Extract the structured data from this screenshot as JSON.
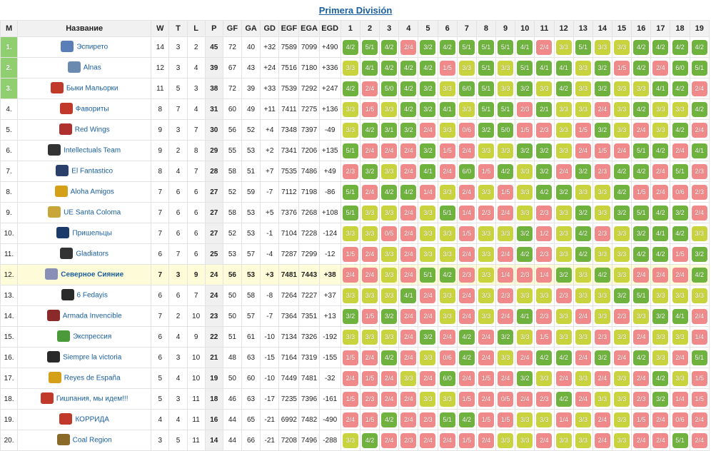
{
  "title": "Primera División",
  "columns": [
    "M",
    "Название",
    "W",
    "T",
    "L",
    "P",
    "GF",
    "GA",
    "GD",
    "EGF",
    "EGA",
    "EGD",
    "1",
    "2",
    "3",
    "4",
    "5",
    "6",
    "7",
    "8",
    "9",
    "10",
    "11",
    "12",
    "13",
    "14",
    "15",
    "16",
    "17",
    "18",
    "19"
  ],
  "colors": {
    "win": "#6fb33e",
    "draw": "#c9d33e",
    "loss": "#f08a8a",
    "top": "#8fcf6f",
    "link": "#1a5fa0"
  },
  "rows": [
    {
      "pos": "1.",
      "name": "Эспирето",
      "logo_color": "#5a7fb8",
      "w": "14",
      "t": "3",
      "l": "2",
      "p": "45",
      "gf": "72",
      "ga": "40",
      "gd": "+32",
      "egf": "7589",
      "ega": "7099",
      "egd": "+490",
      "hl": false,
      "top": true,
      "results": [
        "4/2",
        "5/1",
        "4/2",
        "2/4",
        "3/2",
        "4/2",
        "5/1",
        "5/1",
        "5/1",
        "4/1",
        "2/4",
        "3/3",
        "5/1",
        "3/3",
        "3/3",
        "4/2",
        "4/2",
        "4/2",
        "4/2"
      ]
    },
    {
      "pos": "2.",
      "name": "Alnas",
      "logo_color": "#6a8ab0",
      "w": "12",
      "t": "3",
      "l": "4",
      "p": "39",
      "gf": "67",
      "ga": "43",
      "gd": "+24",
      "egf": "7516",
      "ega": "7180",
      "egd": "+336",
      "hl": false,
      "top": true,
      "results": [
        "3/3",
        "4/1",
        "4/2",
        "4/2",
        "4/2",
        "1/5",
        "3/3",
        "5/1",
        "3/3",
        "5/1",
        "4/1",
        "4/1",
        "3/3",
        "3/2",
        "1/5",
        "4/2",
        "2/4",
        "6/0",
        "5/1"
      ]
    },
    {
      "pos": "3.",
      "name": "Быки Мальорки",
      "logo_color": "#c0392b",
      "w": "11",
      "t": "5",
      "l": "3",
      "p": "38",
      "gf": "72",
      "ga": "39",
      "gd": "+33",
      "egf": "7539",
      "ega": "7292",
      "egd": "+247",
      "hl": false,
      "top": true,
      "results": [
        "4/2",
        "2/4",
        "5/0",
        "4/2",
        "3/2",
        "3/3",
        "6/0",
        "5/1",
        "3/3",
        "3/2",
        "3/3",
        "4/2",
        "3/3",
        "3/2",
        "3/3",
        "3/3",
        "4/1",
        "4/2",
        "2/4"
      ]
    },
    {
      "pos": "4.",
      "name": "Фавориты",
      "logo_color": "#c0392b",
      "w": "8",
      "t": "7",
      "l": "4",
      "p": "31",
      "gf": "60",
      "ga": "49",
      "gd": "+11",
      "egf": "7411",
      "ega": "7275",
      "egd": "+136",
      "hl": false,
      "top": false,
      "results": [
        "3/3",
        "1/5",
        "3/3",
        "4/2",
        "3/2",
        "4/1",
        "3/3",
        "5/1",
        "5/1",
        "2/3",
        "2/1",
        "3/3",
        "3/3",
        "2/4",
        "3/3",
        "4/2",
        "3/3",
        "3/3",
        "4/2"
      ]
    },
    {
      "pos": "5.",
      "name": "Red Wings",
      "logo_color": "#b03030",
      "w": "9",
      "t": "3",
      "l": "7",
      "p": "30",
      "gf": "56",
      "ga": "52",
      "gd": "+4",
      "egf": "7348",
      "ega": "7397",
      "egd": "-49",
      "hl": false,
      "top": false,
      "results": [
        "3/3",
        "4/2",
        "3/1",
        "3/2",
        "2/4",
        "3/3",
        "0/6",
        "3/2",
        "5/0",
        "1/5",
        "2/3",
        "3/3",
        "1/5",
        "3/2",
        "3/3",
        "2/4",
        "3/3",
        "4/2",
        "2/4"
      ]
    },
    {
      "pos": "6.",
      "name": "Intellectuals Team",
      "logo_color": "#333333",
      "w": "9",
      "t": "2",
      "l": "8",
      "p": "29",
      "gf": "55",
      "ga": "53",
      "gd": "+2",
      "egf": "7341",
      "ega": "7206",
      "egd": "+135",
      "hl": false,
      "top": false,
      "results": [
        "5/1",
        "2/4",
        "2/4",
        "2/4",
        "3/2",
        "1/5",
        "2/4",
        "3/3",
        "3/3",
        "3/2",
        "3/2",
        "3/3",
        "2/4",
        "1/5",
        "2/4",
        "5/1",
        "4/2",
        "2/4",
        "4/1"
      ]
    },
    {
      "pos": "7.",
      "name": "El Fantastico",
      "logo_color": "#2a3f6a",
      "w": "8",
      "t": "4",
      "l": "7",
      "p": "28",
      "gf": "58",
      "ga": "51",
      "gd": "+7",
      "egf": "7535",
      "ega": "7486",
      "egd": "+49",
      "hl": false,
      "top": false,
      "results": [
        "2/3",
        "3/2",
        "3/3",
        "2/4",
        "4/1",
        "2/4",
        "6/0",
        "1/5",
        "4/2",
        "3/3",
        "3/2",
        "2/4",
        "3/2",
        "2/3",
        "4/2",
        "4/2",
        "2/4",
        "5/1",
        "2/3"
      ]
    },
    {
      "pos": "8.",
      "name": "Aloha Amigos",
      "logo_color": "#d4a017",
      "w": "7",
      "t": "6",
      "l": "6",
      "p": "27",
      "gf": "52",
      "ga": "59",
      "gd": "-7",
      "egf": "7112",
      "ega": "7198",
      "egd": "-86",
      "hl": false,
      "top": false,
      "results": [
        "5/1",
        "2/4",
        "4/2",
        "4/2",
        "1/4",
        "3/3",
        "2/4",
        "3/3",
        "1/5",
        "3/3",
        "4/2",
        "3/2",
        "3/3",
        "3/3",
        "4/2",
        "1/5",
        "2/4",
        "0/6",
        "2/3"
      ]
    },
    {
      "pos": "9.",
      "name": "UE Santa Coloma",
      "logo_color": "#c8a63a",
      "w": "7",
      "t": "6",
      "l": "6",
      "p": "27",
      "gf": "58",
      "ga": "53",
      "gd": "+5",
      "egf": "7376",
      "ega": "7268",
      "egd": "+108",
      "hl": false,
      "top": false,
      "results": [
        "5/1",
        "3/3",
        "3/3",
        "2/4",
        "3/3",
        "5/1",
        "1/4",
        "2/3",
        "2/4",
        "3/3",
        "2/3",
        "3/3",
        "3/2",
        "3/3",
        "3/2",
        "5/1",
        "4/2",
        "3/2",
        "2/4"
      ]
    },
    {
      "pos": "10.",
      "name": "Пришельцы",
      "logo_color": "#1a3a6a",
      "w": "7",
      "t": "6",
      "l": "6",
      "p": "27",
      "gf": "52",
      "ga": "53",
      "gd": "-1",
      "egf": "7104",
      "ega": "7228",
      "egd": "-124",
      "hl": false,
      "top": false,
      "results": [
        "3/3",
        "3/3",
        "0/5",
        "2/4",
        "3/3",
        "3/3",
        "1/5",
        "3/3",
        "3/3",
        "3/2",
        "1/2",
        "3/3",
        "4/2",
        "2/3",
        "3/3",
        "3/2",
        "4/1",
        "4/2",
        "3/3"
      ]
    },
    {
      "pos": "11.",
      "name": "Gladiators",
      "logo_color": "#333333",
      "w": "6",
      "t": "7",
      "l": "6",
      "p": "25",
      "gf": "53",
      "ga": "57",
      "gd": "-4",
      "egf": "7287",
      "ega": "7299",
      "egd": "-12",
      "hl": false,
      "top": false,
      "results": [
        "1/5",
        "2/4",
        "3/3",
        "2/4",
        "3/3",
        "3/3",
        "2/4",
        "3/3",
        "2/4",
        "4/2",
        "2/3",
        "3/3",
        "4/2",
        "3/3",
        "3/3",
        "4/2",
        "4/2",
        "1/5",
        "3/2"
      ]
    },
    {
      "pos": "12.",
      "name": "Северное Сияние",
      "logo_color": "#8a8fb8",
      "w": "7",
      "t": "3",
      "l": "9",
      "p": "24",
      "gf": "56",
      "ga": "53",
      "gd": "+3",
      "egf": "7481",
      "ega": "7443",
      "egd": "+38",
      "hl": true,
      "top": false,
      "results": [
        "2/4",
        "2/4",
        "3/3",
        "2/4",
        "5/1",
        "4/2",
        "2/3",
        "3/3",
        "1/4",
        "2/3",
        "1/4",
        "3/2",
        "3/3",
        "4/2",
        "3/3",
        "2/4",
        "2/4",
        "2/4",
        "4/2"
      ]
    },
    {
      "pos": "13.",
      "name": "6 Fedayis",
      "logo_color": "#2a2a2a",
      "w": "6",
      "t": "6",
      "l": "7",
      "p": "24",
      "gf": "50",
      "ga": "58",
      "gd": "-8",
      "egf": "7264",
      "ega": "7227",
      "egd": "+37",
      "hl": false,
      "top": false,
      "results": [
        "3/3",
        "3/3",
        "3/3",
        "4/1",
        "2/4",
        "3/3",
        "2/4",
        "3/3",
        "2/3",
        "3/3",
        "3/3",
        "2/3",
        "3/3",
        "3/3",
        "3/2",
        "5/1",
        "3/3",
        "3/3",
        "3/3"
      ]
    },
    {
      "pos": "14.",
      "name": "Armada Invencible",
      "logo_color": "#8a2a2a",
      "w": "7",
      "t": "2",
      "l": "10",
      "p": "23",
      "gf": "50",
      "ga": "57",
      "gd": "-7",
      "egf": "7364",
      "ega": "7351",
      "egd": "+13",
      "hl": false,
      "top": false,
      "results": [
        "3/2",
        "1/5",
        "3/2",
        "2/4",
        "2/4",
        "3/3",
        "2/4",
        "3/3",
        "2/4",
        "4/1",
        "2/3",
        "3/3",
        "2/4",
        "3/3",
        "2/3",
        "3/3",
        "3/2",
        "4/1",
        "2/4"
      ]
    },
    {
      "pos": "15.",
      "name": "Экспрессия",
      "logo_color": "#4a9a3a",
      "w": "6",
      "t": "4",
      "l": "9",
      "p": "22",
      "gf": "51",
      "ga": "61",
      "gd": "-10",
      "egf": "7134",
      "ega": "7326",
      "egd": "-192",
      "hl": false,
      "top": false,
      "results": [
        "3/3",
        "3/3",
        "3/3",
        "2/4",
        "3/2",
        "2/4",
        "4/2",
        "2/4",
        "3/2",
        "3/3",
        "1/5",
        "3/3",
        "3/3",
        "2/3",
        "3/3",
        "2/4",
        "3/3",
        "3/3",
        "1/4"
      ]
    },
    {
      "pos": "16.",
      "name": "Siempre la victoria",
      "logo_color": "#2a2a2a",
      "w": "6",
      "t": "3",
      "l": "10",
      "p": "21",
      "gf": "48",
      "ga": "63",
      "gd": "-15",
      "egf": "7164",
      "ega": "7319",
      "egd": "-155",
      "hl": false,
      "top": false,
      "results": [
        "1/5",
        "2/4",
        "4/2",
        "2/4",
        "3/3",
        "0/6",
        "4/2",
        "2/4",
        "3/3",
        "2/4",
        "4/2",
        "4/2",
        "2/4",
        "3/2",
        "2/4",
        "4/2",
        "3/3",
        "2/4",
        "5/1"
      ]
    },
    {
      "pos": "17.",
      "name": "Reyes de España",
      "logo_color": "#d4a017",
      "w": "5",
      "t": "4",
      "l": "10",
      "p": "19",
      "gf": "50",
      "ga": "60",
      "gd": "-10",
      "egf": "7449",
      "ega": "7481",
      "egd": "-32",
      "hl": false,
      "top": false,
      "results": [
        "2/4",
        "1/5",
        "2/4",
        "3/3",
        "2/4",
        "6/0",
        "2/4",
        "1/5",
        "2/4",
        "3/2",
        "3/3",
        "2/4",
        "3/3",
        "2/4",
        "3/3",
        "2/4",
        "4/2",
        "3/3",
        "1/5"
      ]
    },
    {
      "pos": "18.",
      "name": "Гишпания, мы идем!!!",
      "logo_color": "#c0392b",
      "w": "5",
      "t": "3",
      "l": "11",
      "p": "18",
      "gf": "46",
      "ga": "63",
      "gd": "-17",
      "egf": "7235",
      "ega": "7396",
      "egd": "-161",
      "hl": false,
      "top": false,
      "results": [
        "1/5",
        "2/3",
        "2/4",
        "2/4",
        "3/3",
        "3/3",
        "1/5",
        "2/4",
        "0/5",
        "2/4",
        "2/3",
        "4/2",
        "2/4",
        "3/3",
        "3/3",
        "2/3",
        "3/2",
        "1/4",
        "1/5"
      ]
    },
    {
      "pos": "19.",
      "name": "КОРРИДА",
      "logo_color": "#c0392b",
      "w": "4",
      "t": "4",
      "l": "11",
      "p": "16",
      "gf": "44",
      "ga": "65",
      "gd": "-21",
      "egf": "6992",
      "ega": "7482",
      "egd": "-490",
      "hl": false,
      "top": false,
      "results": [
        "2/4",
        "1/5",
        "4/2",
        "2/4",
        "2/3",
        "5/1",
        "4/2",
        "1/5",
        "1/5",
        "3/3",
        "3/3",
        "1/4",
        "3/3",
        "2/4",
        "3/3",
        "1/5",
        "2/4",
        "0/6",
        "2/4"
      ]
    },
    {
      "pos": "20.",
      "name": "Coal Region",
      "logo_color": "#8a6a2a",
      "w": "3",
      "t": "5",
      "l": "11",
      "p": "14",
      "gf": "44",
      "ga": "66",
      "gd": "-21",
      "egf": "7208",
      "ega": "7496",
      "egd": "-288",
      "hl": false,
      "top": false,
      "results": [
        "3/3",
        "4/2",
        "2/4",
        "2/3",
        "2/4",
        "2/4",
        "1/5",
        "2/4",
        "3/3",
        "3/3",
        "2/4",
        "3/3",
        "3/3",
        "2/4",
        "3/3",
        "2/4",
        "2/4",
        "5/1",
        "2/4"
      ]
    }
  ]
}
